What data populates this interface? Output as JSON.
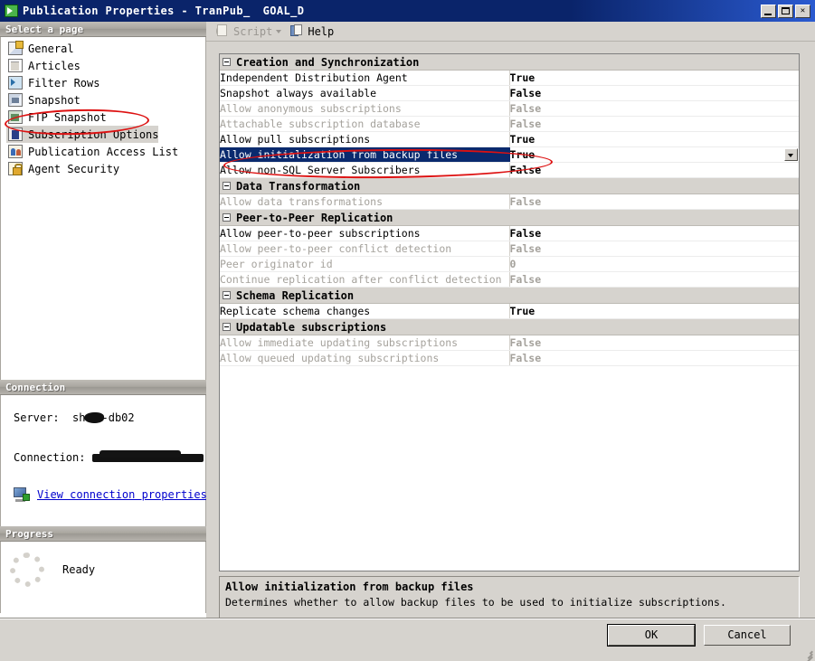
{
  "window": {
    "title_prefix": "Publication Properties - TranPub_",
    "title_suffix": "GOAL_D",
    "icon": "publication-icon",
    "minimize_label": "",
    "maximize_label": "",
    "close_label": "✕"
  },
  "sidebar": {
    "header": "Select a page",
    "items": [
      {
        "label": "General",
        "icon": "general-page-icon",
        "selected": false
      },
      {
        "label": "Articles",
        "icon": "articles-page-icon",
        "selected": false
      },
      {
        "label": "Filter Rows",
        "icon": "filter-rows-page-icon",
        "selected": false
      },
      {
        "label": "Snapshot",
        "icon": "snapshot-page-icon",
        "selected": false
      },
      {
        "label": "FTP Snapshot",
        "icon": "ftp-snapshot-page-icon",
        "selected": false
      },
      {
        "label": "Subscription Options",
        "icon": "subscription-options-page-icon",
        "selected": true
      },
      {
        "label": "Publication Access List",
        "icon": "publication-access-list-page-icon",
        "selected": false
      },
      {
        "label": "Agent Security",
        "icon": "agent-security-page-icon",
        "selected": false
      }
    ]
  },
  "connection": {
    "header": "Connection",
    "server_label": "Server:",
    "server_value_prefix": "sh",
    "server_value_suffix": "-db02",
    "connection_label": "Connection:",
    "connection_value": "",
    "view_properties_link": "View connection properties"
  },
  "progress": {
    "header": "Progress",
    "status": "Ready",
    "spinner_icon": "loading-spinner-icon"
  },
  "toolbar": {
    "script_label": "Script",
    "script_icon": "script-icon",
    "script_caret_icon": "chevron-down-icon",
    "help_label": "Help",
    "help_icon": "help-icon"
  },
  "grid": {
    "sections": [
      {
        "title": "Creation and Synchronization",
        "rows": [
          {
            "name": "Independent Distribution Agent",
            "value": "True",
            "dim": false,
            "selected": false
          },
          {
            "name": "Snapshot always available",
            "value": "False",
            "dim": false,
            "selected": false
          },
          {
            "name": "Allow anonymous subscriptions",
            "value": "False",
            "dim": true,
            "selected": false
          },
          {
            "name": "Attachable subscription database",
            "value": "False",
            "dim": true,
            "selected": false
          },
          {
            "name": "Allow pull subscriptions",
            "value": "True",
            "dim": false,
            "selected": false
          },
          {
            "name": "Allow initialization from backup files",
            "value": "True",
            "dim": false,
            "selected": true
          },
          {
            "name": "Allow non-SQL Server Subscribers",
            "value": "False",
            "dim": false,
            "selected": false
          }
        ]
      },
      {
        "title": "Data Transformation",
        "rows": [
          {
            "name": "Allow data transformations",
            "value": "False",
            "dim": true,
            "selected": false
          }
        ]
      },
      {
        "title": "Peer-to-Peer Replication",
        "rows": [
          {
            "name": "Allow peer-to-peer subscriptions",
            "value": "False",
            "dim": false,
            "selected": false
          },
          {
            "name": "Allow peer-to-peer conflict detection",
            "value": "False",
            "dim": true,
            "selected": false
          },
          {
            "name": "Peer originator id",
            "value": "0",
            "dim": true,
            "selected": false
          },
          {
            "name": "Continue replication after conflict detection",
            "value": "False",
            "dim": true,
            "selected": false
          }
        ]
      },
      {
        "title": "Schema Replication",
        "rows": [
          {
            "name": "Replicate schema changes",
            "value": "True",
            "dim": false,
            "selected": false
          }
        ]
      },
      {
        "title": "Updatable subscriptions",
        "rows": [
          {
            "name": "Allow immediate updating subscriptions",
            "value": "False",
            "dim": true,
            "selected": false
          },
          {
            "name": "Allow queued updating subscriptions",
            "value": "False",
            "dim": true,
            "selected": false
          }
        ]
      }
    ]
  },
  "description": {
    "title": "Allow initialization from backup files",
    "text": "Determines whether to allow backup files to be used to initialize subscriptions."
  },
  "footer": {
    "ok_label": "OK",
    "cancel_label": "Cancel"
  },
  "colors": {
    "titlebar": "#0a246a",
    "selection": "#0a2a6e",
    "dialog_face": "#d6d3ce",
    "annotation": "#dd1111",
    "link": "#0000cd"
  }
}
